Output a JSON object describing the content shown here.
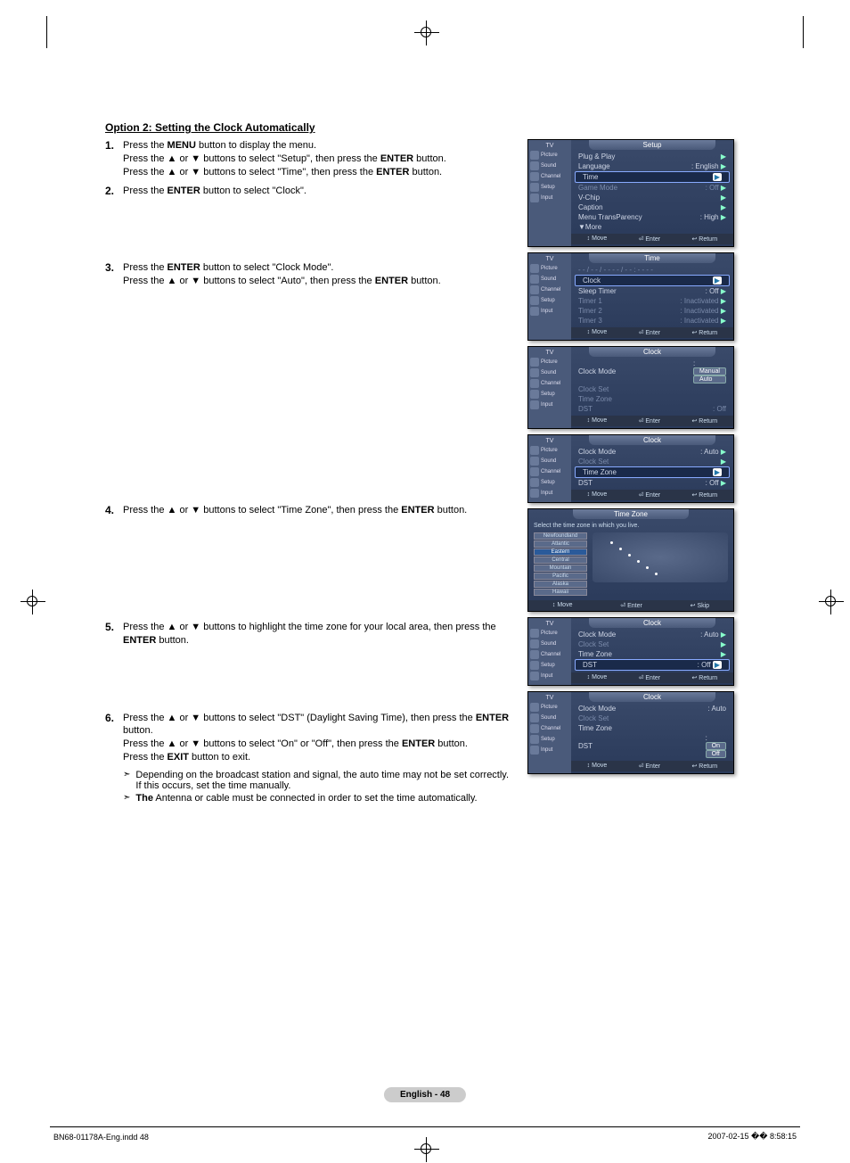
{
  "section_title": "Option 2: Setting the Clock Automatically",
  "steps": [
    {
      "num": "1.",
      "lines": [
        "Press the <b>MENU</b> button to display the menu.",
        "Press the ▲ or ▼ buttons to select \"Setup\", then press the <b>ENTER</b> button.",
        "Press the ▲ or ▼ buttons to select \"Time\", then press the <b>ENTER</b> button."
      ]
    },
    {
      "num": "2.",
      "lines": [
        "Press the <b>ENTER</b> button to select \"Clock\"."
      ]
    },
    {
      "num": "3.",
      "lines": [
        "Press the <b>ENTER</b> button to select \"Clock Mode\".",
        "Press the ▲ or ▼ buttons to select \"Auto\", then press the <b>ENTER</b> button."
      ]
    },
    {
      "num": "4.",
      "lines": [
        "Press the ▲ or ▼ buttons to select \"Time Zone\", then press the <b>ENTER</b> button."
      ]
    },
    {
      "num": "5.",
      "lines": [
        "Press the ▲ or ▼ buttons to highlight the time zone for your local area, then press the <b>ENTER</b> button."
      ]
    },
    {
      "num": "6.",
      "lines": [
        "Press the ▲ or ▼ buttons to select \"DST\" (Daylight Saving Time), then press the <b>ENTER</b> button.",
        "Press the ▲ or ▼ buttons to select \"On\" or \"Off\", then press the <b>ENTER</b> button.",
        "Press the <b>EXIT</b> button to exit."
      ]
    }
  ],
  "notes": [
    "Depending on the broadcast station and signal, the auto time may not be set correctly. If this occurs, set the time manually.",
    "<b>The</b> Antenna or cable must be connected in order to set the time automatically."
  ],
  "sidebar": {
    "tv": "TV",
    "cats": [
      "Picture",
      "Sound",
      "Channel",
      "Setup",
      "Input"
    ]
  },
  "osd_setup": {
    "title": "Setup",
    "rows": [
      {
        "label": "Plug & Play",
        "val": "",
        "arrow": true
      },
      {
        "label": "Language",
        "val": ": English",
        "arrow": true
      },
      {
        "label": "Time",
        "val": "",
        "arrow": true,
        "sel": true
      },
      {
        "label": "Game Mode",
        "val": ": Off",
        "arrow": true,
        "dim": true
      },
      {
        "label": "V-Chip",
        "val": "",
        "arrow": true
      },
      {
        "label": "Caption",
        "val": "",
        "arrow": true
      },
      {
        "label": "Menu TransParency",
        "val": ": High",
        "arrow": true
      },
      {
        "label": "▼More",
        "val": ""
      }
    ],
    "footer": [
      "Move",
      "Enter",
      "Return"
    ]
  },
  "osd_time": {
    "title": "Time",
    "datetime": "- - / - - / - - - - / - - : - - - -",
    "rows": [
      {
        "label": "Clock",
        "val": "",
        "arrow": true,
        "sel": true
      },
      {
        "label": "Sleep Timer",
        "val": ": Off",
        "arrow": true
      },
      {
        "label": "Timer 1",
        "val": ": Inactivated",
        "arrow": true,
        "dim": true
      },
      {
        "label": "Timer 2",
        "val": ": Inactivated",
        "arrow": true,
        "dim": true
      },
      {
        "label": "Timer 3",
        "val": ": Inactivated",
        "arrow": true,
        "dim": true
      }
    ],
    "footer": [
      "Move",
      "Enter",
      "Return"
    ]
  },
  "osd_clock1": {
    "title": "Clock",
    "rows": [
      {
        "label": "Clock Mode",
        "val": ":",
        "drop": [
          "Manual",
          "Auto"
        ]
      },
      {
        "label": "Clock Set",
        "val": "",
        "dim": true
      },
      {
        "label": "Time Zone",
        "val": "",
        "dim": true
      },
      {
        "label": "DST",
        "val": ": Off",
        "dim": true
      }
    ],
    "footer": [
      "Move",
      "Enter",
      "Return"
    ]
  },
  "osd_clock2": {
    "title": "Clock",
    "rows": [
      {
        "label": "Clock Mode",
        "val": ": Auto",
        "arrow": true
      },
      {
        "label": "Clock Set",
        "val": "",
        "arrow": true,
        "dim": true
      },
      {
        "label": "Time Zone",
        "val": "",
        "arrow": true,
        "sel": true
      },
      {
        "label": "DST",
        "val": ": Off",
        "arrow": true
      }
    ],
    "footer": [
      "Move",
      "Enter",
      "Return"
    ]
  },
  "osd_timezone": {
    "title": "Time Zone",
    "sub": "Select the time zone in which you live.",
    "items": [
      "Newfoundland",
      "Atlantic",
      "Eastern",
      "Central",
      "Mountain",
      "Pacific",
      "Alaska",
      "Hawaii"
    ],
    "sel_index": 2,
    "footer": [
      "Move",
      "Enter",
      "Skip"
    ]
  },
  "osd_clock3": {
    "title": "Clock",
    "rows": [
      {
        "label": "Clock Mode",
        "val": ": Auto",
        "arrow": true
      },
      {
        "label": "Clock Set",
        "val": "",
        "arrow": true,
        "dim": true
      },
      {
        "label": "Time Zone",
        "val": "",
        "arrow": true
      },
      {
        "label": "DST",
        "val": ": Off",
        "arrow": true,
        "sel": true
      }
    ],
    "footer": [
      "Move",
      "Enter",
      "Return"
    ]
  },
  "osd_clock4": {
    "title": "Clock",
    "rows": [
      {
        "label": "Clock Mode",
        "val": ": Auto"
      },
      {
        "label": "Clock Set",
        "val": "",
        "dim": true
      },
      {
        "label": "Time Zone",
        "val": ""
      },
      {
        "label": "DST",
        "val": ":",
        "drop": [
          "On",
          "Off"
        ]
      }
    ],
    "footer": [
      "Move",
      "Enter",
      "Return"
    ]
  },
  "page_badge": "English - 48",
  "footer_left": "BN68-01178A-Eng.indd   48",
  "footer_right": "2007-02-15   �� 8:58:15"
}
